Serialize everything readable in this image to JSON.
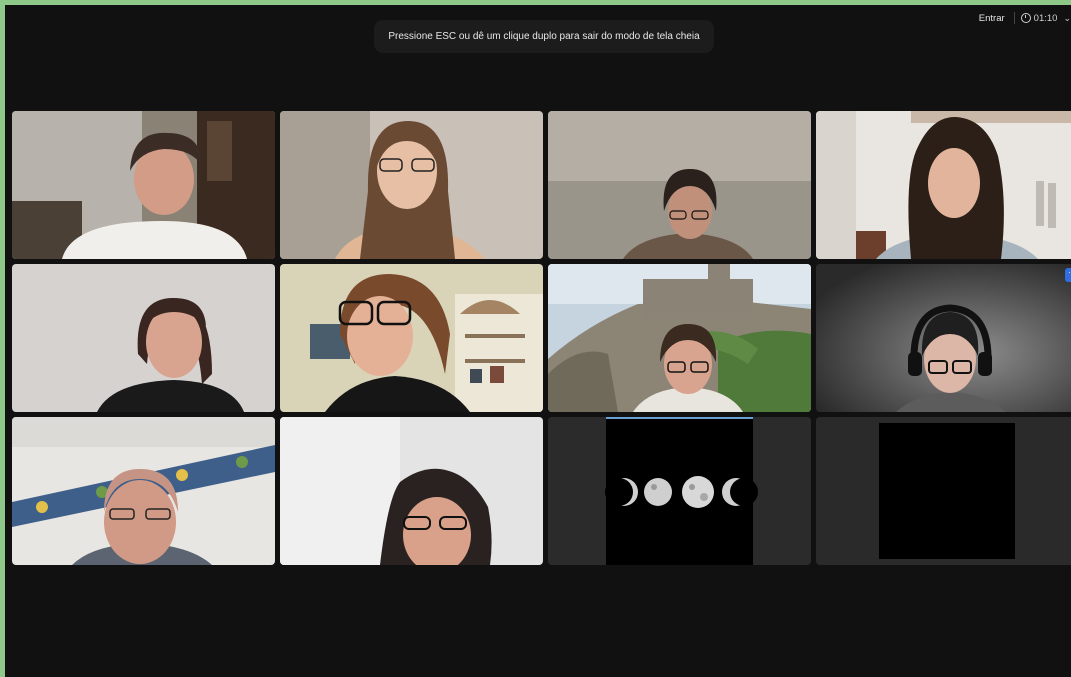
{
  "banner": {
    "text": "Pressione ESC ou dê um clique duplo para sair do modo de tela cheia"
  },
  "topbar": {
    "enter_label": "Entrar",
    "timer": "01:10",
    "chevron": "⌄"
  },
  "more_label": "···",
  "colors": {
    "active_border": "#64d35d",
    "accent": "#2d6ee0",
    "background": "#111111"
  }
}
